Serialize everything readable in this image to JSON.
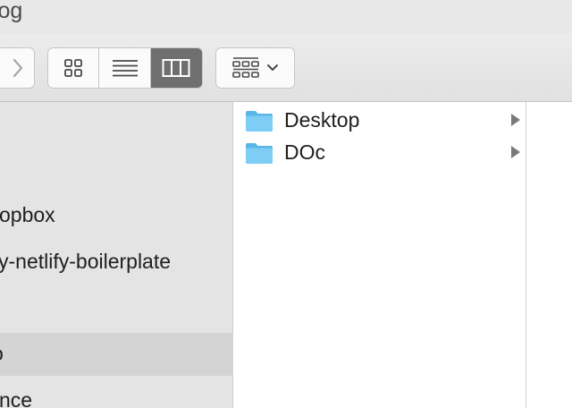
{
  "window": {
    "title": "blog"
  },
  "toolbar": {
    "nav_forward": "chevron-right-icon",
    "view_modes": [
      {
        "name": "icon-view",
        "icon": "grid-icon",
        "active": false
      },
      {
        "name": "list-view",
        "icon": "list-icon",
        "active": false
      },
      {
        "name": "column-view",
        "icon": "columns-icon",
        "active": true
      }
    ],
    "arrange": {
      "icon": "arrange-grid-icon",
      "dropdown": "chevron-down-icon"
    }
  },
  "sidebar": {
    "items": [
      {
        "label": "Dropbox",
        "visible_text": "opbox",
        "selected": false
      },
      {
        "label": "netlify-boilerplate",
        "visible_text": "y-netlify-boilerplate",
        "selected": false
      },
      {
        "label": "blog",
        "visible_text": "o",
        "selected": true
      },
      {
        "label": "ance",
        "visible_text": "nce",
        "selected": false
      }
    ]
  },
  "column": {
    "items": [
      {
        "name": "Desktop",
        "icon": "folder-icon",
        "has_children": true
      },
      {
        "name": "DOc",
        "icon": "folder-icon",
        "has_children": true
      }
    ]
  },
  "colors": {
    "titlebar": "#e8e8e8",
    "toolbar": "#e4e4e4",
    "sidebar": "#e4e4e4",
    "sidebar_selected": "#d4d4d4",
    "active_segment": "#6f6f6f",
    "folder": "#6ec6f2"
  }
}
